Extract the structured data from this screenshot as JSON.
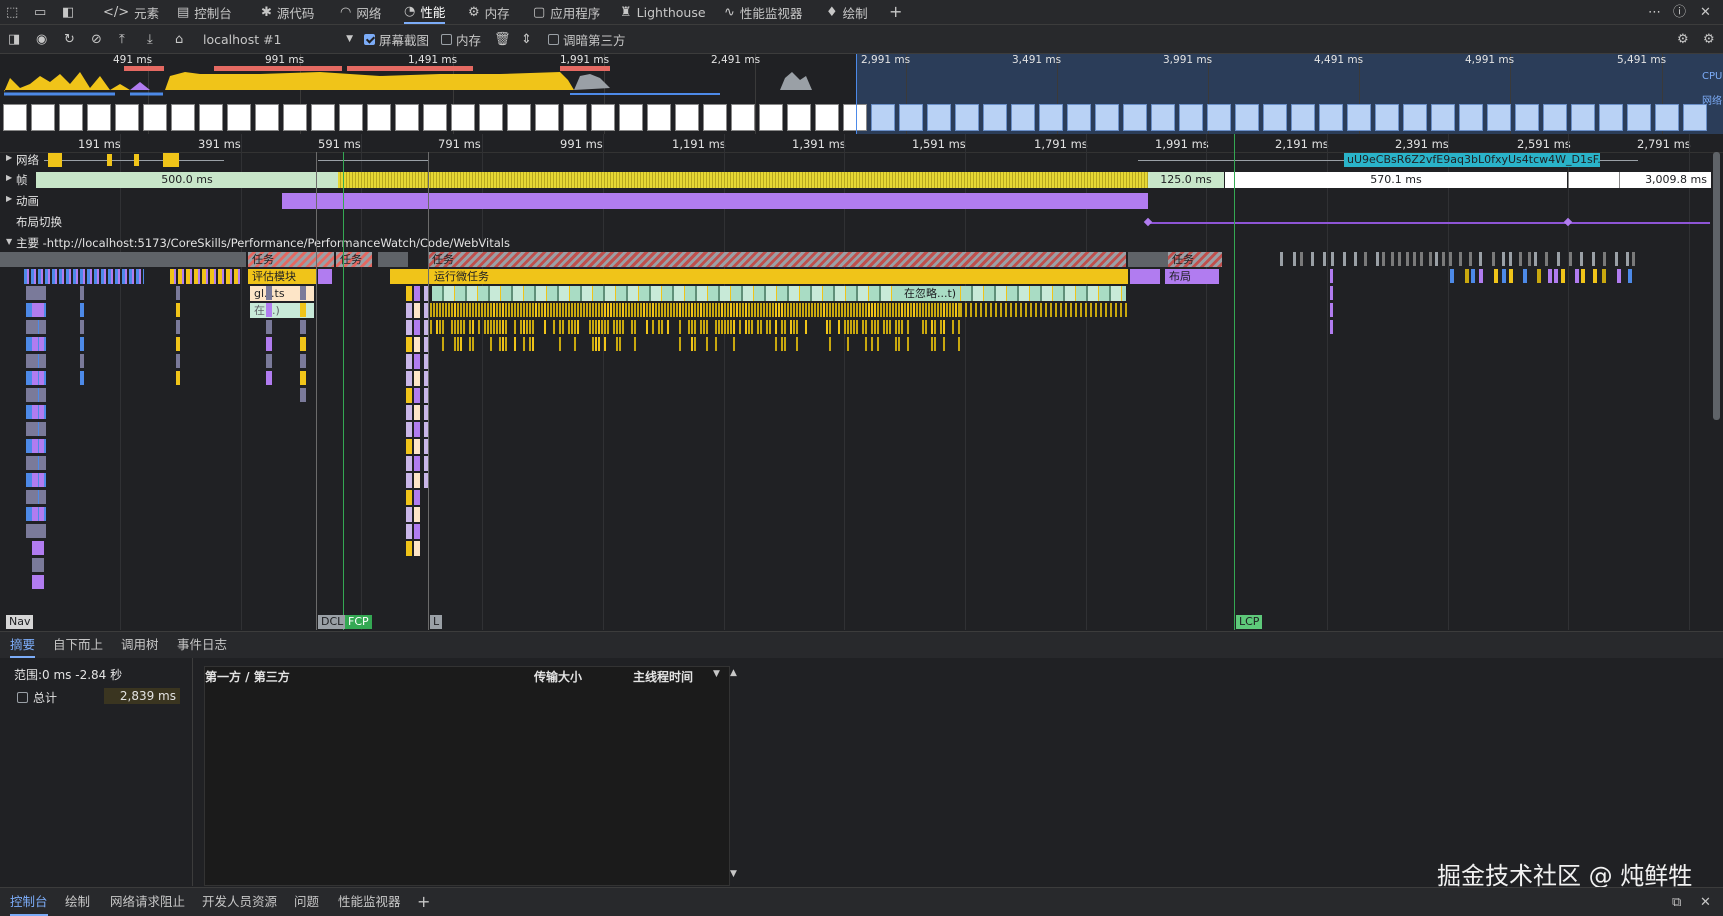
{
  "tabs": {
    "elements": "元素",
    "console": "控制台",
    "sources": "源代码",
    "network": "网络",
    "performance": "性能",
    "memory": "内存",
    "application": "应用程序",
    "lighthouse": "Lighthouse",
    "perf_monitor": "性能监视器",
    "recorder": "绘制"
  },
  "toolbar": {
    "target": "localhost #1",
    "screenshots_label": "屏幕截图",
    "screenshots_checked": true,
    "memory_label": "内存",
    "memory_checked": false,
    "dim_third_party_label": "调暗第三方",
    "dim_third_party_checked": false
  },
  "overview": {
    "ticks": [
      "491 ms",
      "991 ms",
      "1,491 ms",
      "1,991 ms",
      "2,491 ms",
      "2,991 ms",
      "3,491 ms",
      "3,991 ms",
      "4,491 ms",
      "4,991 ms",
      "5,491 ms"
    ],
    "cpu_label": "CPU",
    "net_label": "网络"
  },
  "ruler": {
    "ticks": [
      "191 ms",
      "391 ms",
      "591 ms",
      "791 ms",
      "991 ms",
      "1,191 ms",
      "1,391 ms",
      "1,591 ms",
      "1,791 ms",
      "1,991 ms",
      "2,191 ms",
      "2,391 ms",
      "2,591 ms",
      "2,791 ms"
    ]
  },
  "tracks": {
    "network": "网络",
    "network_request": "uU9eCBsR6Z2vfE9aq3bL0fxyUs4tcw4W_D1sF...",
    "frames": "帧",
    "frame_500": "500.0 ms",
    "frame_125": "125.0 ms",
    "frame_570": "570.1 ms",
    "frame_3009": "3,009.8 ms",
    "animations": "动画",
    "layout_shifts": "布局切换",
    "main": "主要 -http://localhost:5173/CoreSkills/Performance/PerformanceWatch/Code/WebVitals"
  },
  "flame": {
    "task1": "任务",
    "task2": "任务",
    "task3": "任务",
    "task4": "任务",
    "eval_module": "评估模块",
    "run_microtasks": "运行微任务",
    "layout": "布局",
    "gl_ts": "gl...ts",
    "in_ellipsis": "在...)",
    "ignored": "在忽略...t)"
  },
  "markers": {
    "nav": "Nav",
    "dcl": "DCL",
    "fcp": "FCP",
    "l": "L",
    "lcp": "LCP"
  },
  "bottom_tabs": {
    "summary": "摘要",
    "bottom_up": "自下而上",
    "call_tree": "调用树",
    "event_log": "事件日志"
  },
  "summary": {
    "range": "范围:0 ms -2.84 秒",
    "total_label": "总计",
    "total_value": "2,839 ms",
    "col_party": "第一方 / 第三方",
    "col_transfer": "传输大小",
    "col_main_thread": "主线程时间"
  },
  "drawer": {
    "console": "控制台",
    "rendering": "绘制",
    "network_blocking": "网络请求阻止",
    "dev_resources": "开发人员资源",
    "issues": "问题",
    "perf_monitor": "性能监视器"
  },
  "watermark": "掘金技术社区 @ 炖鲜牲",
  "colors": {
    "scripting": "#f0c419",
    "rendering": "#b17cf0",
    "painting": "#7cc77c",
    "idle_frame": "#c8e6c9",
    "accent": "#7cacf8",
    "long_task": "#e46962",
    "network_blue": "#2ab3c9"
  }
}
